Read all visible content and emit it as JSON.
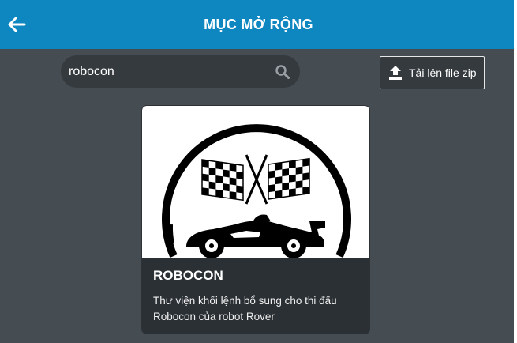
{
  "header": {
    "title": "MỤC MỞ RỘNG",
    "back_icon": "arrow-left-icon"
  },
  "search": {
    "value": "robocon",
    "icon": "search-icon"
  },
  "upload": {
    "label": "Tải lên file zip",
    "icon": "upload-icon"
  },
  "extensions": [
    {
      "title": "ROBOCON",
      "description": "Thư viện khối lệnh bổ sung cho thi đấu Robocon của robot Rover",
      "image": "racing-flags-car-logo"
    }
  ],
  "colors": {
    "header_bg": "#0e86c0",
    "page_bg": "#454c52",
    "input_bg": "#353a3f",
    "card_body_bg": "#2b3035"
  }
}
